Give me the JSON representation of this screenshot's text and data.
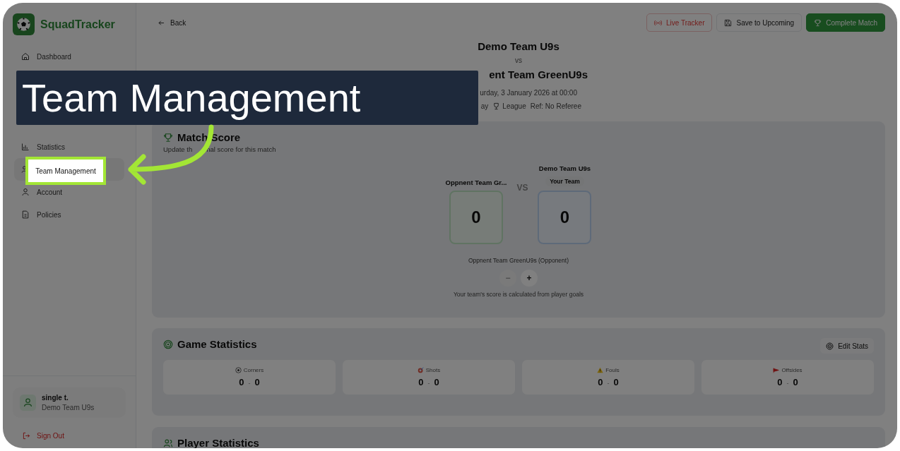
{
  "app": {
    "name": "SquadTracker"
  },
  "sidebar": {
    "items": [
      {
        "label": "Dashboard",
        "kind": "home",
        "spotlight": false
      },
      {
        "label": "Statistics",
        "kind": "chart",
        "spotlight": false
      },
      {
        "label": "Team Management",
        "kind": "team",
        "spotlight": true
      },
      {
        "label": "Account",
        "kind": "user",
        "spotlight": false
      },
      {
        "label": "Policies",
        "kind": "doc",
        "spotlight": false
      }
    ],
    "user": {
      "name": "single t.",
      "team": "Demo Team U9s"
    },
    "sign_out": "Sign Out"
  },
  "callout": {
    "text": "Team Management"
  },
  "header": {
    "back": "Back",
    "buttons": [
      {
        "label": "Live Tracker",
        "kind": "danger"
      },
      {
        "label": "Save to Upcoming",
        "kind": "outline"
      },
      {
        "label": "Complete Match",
        "kind": "primary"
      }
    ]
  },
  "match": {
    "home": "Demo Team U9s",
    "vs": "vs",
    "away": "ent Team GreenU9s",
    "date": "urday, 3 January 2026 at 00:00",
    "meta": [
      "ay",
      "League",
      "Ref: No Referee"
    ]
  },
  "score_card": {
    "title": "Match Score",
    "subtitle_parts": [
      "Update th",
      "nal score for this match"
    ],
    "opponent": {
      "name": "Oppnent Team Gr...",
      "score": "0"
    },
    "vs": "VS",
    "own": {
      "name": "Demo Team U9s",
      "badge": "Your Team",
      "score": "0"
    },
    "adjust_label": "Oppnent Team GreenU9s (Opponent)",
    "controls": [
      {
        "label": "−",
        "disabled": true
      },
      {
        "label": "+",
        "disabled": false
      }
    ],
    "note": "Your team's score is calculated from player goals"
  },
  "game_stats": {
    "title": "Game Statistics",
    "edit": "Edit Stats",
    "stats": [
      {
        "label": "Corners",
        "kind": "ball",
        "home": "0",
        "sep": "-",
        "away": "0"
      },
      {
        "label": "Shots",
        "kind": "target",
        "home": "0",
        "sep": "-",
        "away": "0"
      },
      {
        "label": "Fouls",
        "kind": "warning",
        "home": "0",
        "sep": "-",
        "away": "0"
      },
      {
        "label": "Offsides",
        "kind": "flag",
        "home": "0",
        "sep": "-",
        "away": "0"
      }
    ]
  },
  "player_stats": {
    "title": "Player Statistics"
  }
}
